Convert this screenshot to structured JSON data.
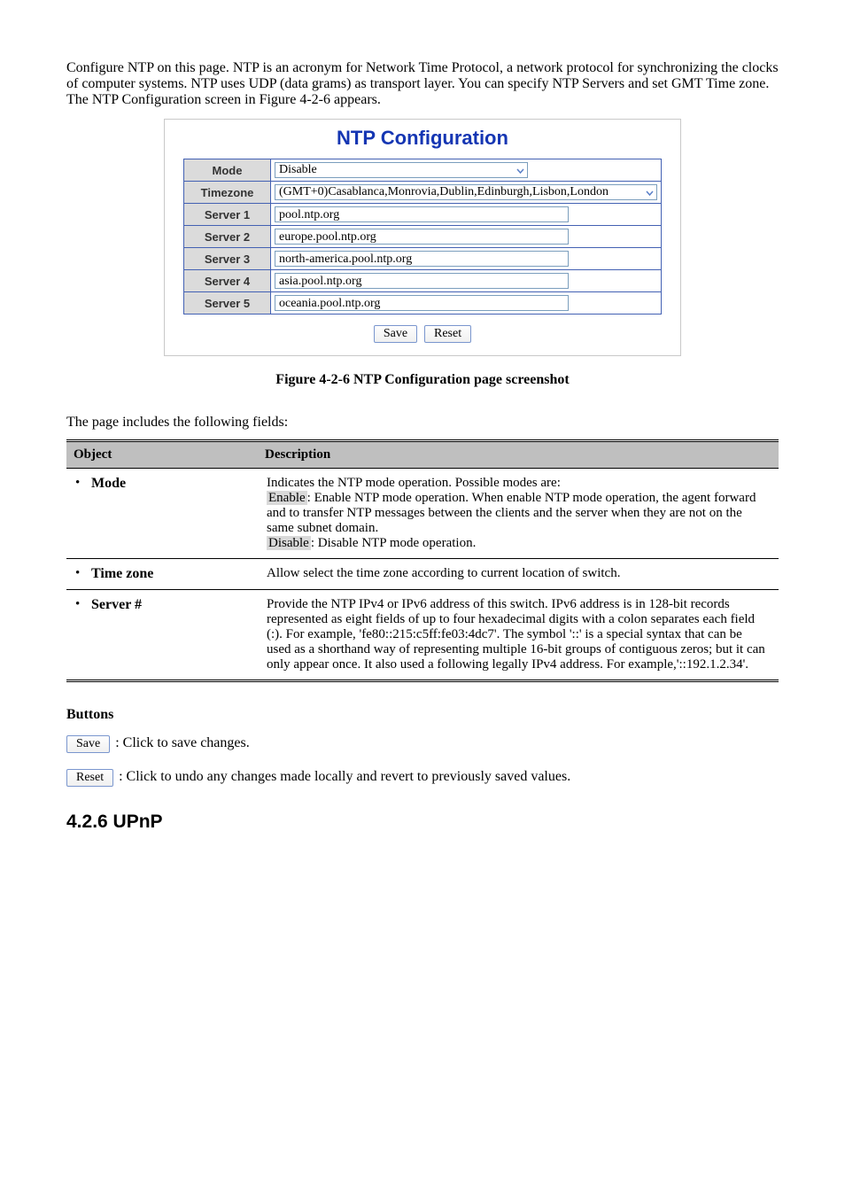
{
  "intro": "Configure NTP on this page. NTP is an acronym for Network Time Protocol, a network protocol for synchronizing the clocks of computer systems. NTP uses UDP (data grams) as transport layer. You can specify NTP Servers and set GMT Time zone. The NTP Configuration screen in Figure 4-2-6 appears.",
  "figureCaption": "Figure 4-2-6 NTP Configuration page screenshot",
  "screenshot": {
    "title": "NTP Configuration",
    "rows": {
      "modeLabel": "Mode",
      "modeValue": "Disable",
      "timezoneLabel": "Timezone",
      "timezoneValue": "(GMT+0)Casablanca,Monrovia,Dublin,Edinburgh,Lisbon,London",
      "server1Label": "Server 1",
      "server1Value": "pool.ntp.org",
      "server2Label": "Server 2",
      "server2Value": "europe.pool.ntp.org",
      "server3Label": "Server 3",
      "server3Value": "north-america.pool.ntp.org",
      "server4Label": "Server 4",
      "server4Value": "asia.pool.ntp.org",
      "server5Label": "Server 5",
      "server5Value": "oceania.pool.ntp.org"
    },
    "saveLabel": "Save",
    "resetLabel": "Reset"
  },
  "descIntro": "The page includes the following fields:",
  "descTable": {
    "headObject": "Object",
    "headDesc": "Description",
    "rows": [
      {
        "object": "Mode",
        "desc": "Indicates the NTP mode operation. Possible modes are:",
        "sub": [
          {
            "k": "Enable",
            "v": ": Enable NTP mode operation. When enable NTP mode operation, the agent forward and to transfer NTP messages between the clients and the server when they are not on the same subnet domain."
          },
          {
            "k": "Disable",
            "v": ": Disable NTP mode operation."
          }
        ]
      },
      {
        "object": "Time zone",
        "desc": "Allow select the time zone according to current location of switch."
      },
      {
        "object": "Server #",
        "desc": "Provide the NTP IPv4 or IPv6 address of this switch. IPv6 address is in 128-bit records represented as eight fields of up to four hexadecimal digits with a colon separates each field (:). For example, 'fe80::215:c5ff:fe03:4dc7'. The symbol '::' is a special syntax that can be used as a shorthand way of representing multiple 16-bit groups of contiguous zeros; but it can only appear once. It also used a following legally IPv4 address. For example,'::192.1.2.34'."
      }
    ]
  },
  "buttonsIntro": "Buttons",
  "saveBtn": {
    "label": "Save",
    "desc": ": Click to save changes."
  },
  "resetBtn": {
    "label": "Reset",
    "desc": ": Click to undo any changes made locally and revert to previously saved values."
  },
  "sectionHeading": "4.2.6 UPnP"
}
